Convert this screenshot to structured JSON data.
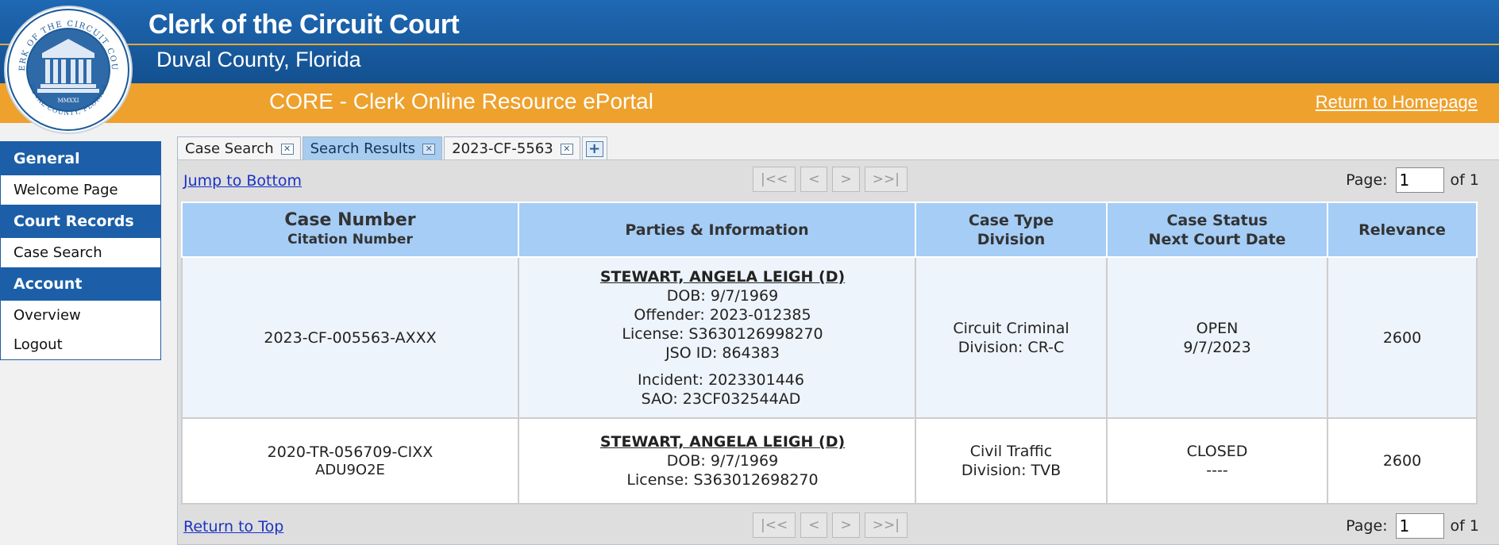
{
  "header": {
    "title": "Clerk of the Circuit Court",
    "subtitle": "Duval County, Florida",
    "portal_name": "CORE - Clerk Online Resource ePortal",
    "home_link": "Return to Homepage",
    "seal_top_text": "CLERK OF THE CIRCUIT COURT",
    "seal_bottom_text": "DUVAL COUNTY, FLORIDA",
    "seal_year": "MMXXI"
  },
  "sidebar": {
    "sections": [
      {
        "heading": "General",
        "items": [
          "Welcome Page"
        ]
      },
      {
        "heading": "Court Records",
        "items": [
          "Case Search"
        ]
      },
      {
        "heading": "Account",
        "items": [
          "Overview",
          "Logout"
        ]
      }
    ]
  },
  "tabs": [
    {
      "label": "Case Search",
      "active": false
    },
    {
      "label": "Search Results",
      "active": true
    },
    {
      "label": "2023-CF-5563",
      "active": false
    }
  ],
  "pager": {
    "first": "|<<",
    "prev": "<",
    "next": ">",
    "last": ">>|",
    "page_label": "Page:",
    "page_value": "1",
    "of_label": "of 1",
    "jump_bottom": "Jump to Bottom",
    "return_top": "Return to Top"
  },
  "table": {
    "headers": {
      "case_number": "Case Number",
      "citation_number": "Citation Number",
      "parties": "Parties & Information",
      "case_type": "Case Type",
      "division": "Division",
      "case_status": "Case Status",
      "next_court_date": "Next Court Date",
      "relevance": "Relevance"
    },
    "rows": [
      {
        "case_number": "2023-CF-005563-AXXX",
        "citation": "",
        "party_name": "STEWART, ANGELA LEIGH (D)",
        "dob": "DOB: 9/7/1969",
        "offender": "Offender: 2023-012385",
        "license": "License: S3630126998270",
        "jso_id": "JSO ID: 864383",
        "incident": "Incident: 2023301446",
        "sao": "SAO: 23CF032544AD",
        "case_type": "Circuit Criminal",
        "division": "Division: CR-C",
        "status": "OPEN",
        "next_date": "9/7/2023",
        "relevance": "2600"
      },
      {
        "case_number": "2020-TR-056709-CIXX",
        "citation": "ADU9O2E",
        "party_name": "STEWART, ANGELA LEIGH (D)",
        "dob": "DOB: 9/7/1969",
        "license": "License: S363012698270",
        "case_type": "Civil Traffic",
        "division": "Division: TVB",
        "status": "CLOSED",
        "next_date": "----",
        "relevance": "2600"
      }
    ]
  },
  "colors": {
    "header_blue": "#1b5ea3",
    "header_orange": "#eea12c",
    "table_header": "#a5cdf6",
    "link": "#1a33c4"
  }
}
